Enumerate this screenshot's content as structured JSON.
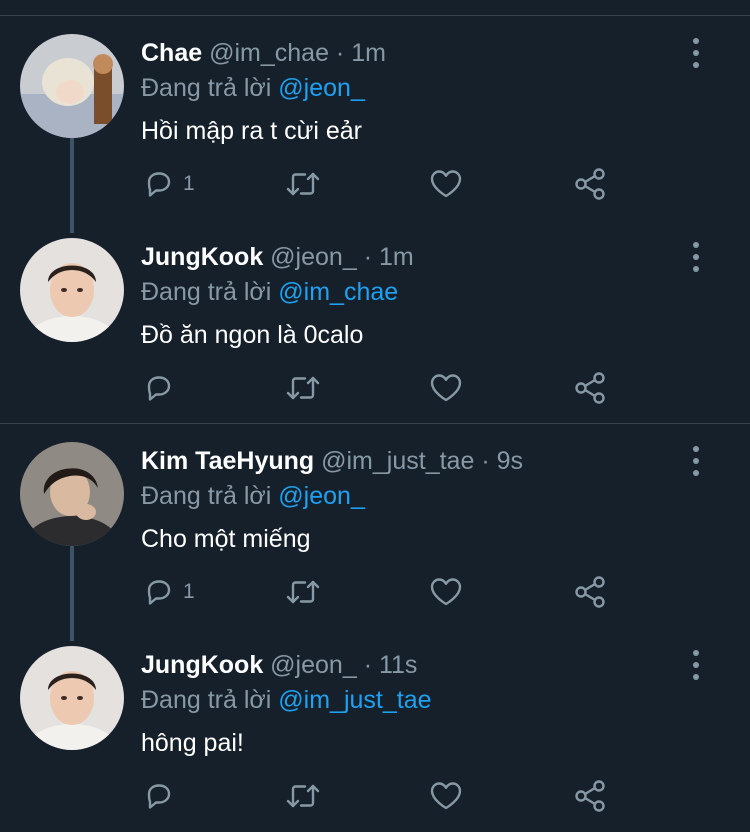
{
  "labels": {
    "replying_prefix": "Đang trả lời"
  },
  "colors": {
    "background": "#15202b",
    "name": "#ffffff",
    "secondary": "#8899a6",
    "mention": "#1da1f2",
    "thread_line": "#3d5466"
  },
  "tweets": [
    {
      "name": "Chae",
      "handle": "@im_chae",
      "dot": "·",
      "time": "1m",
      "mention": "@jeon_",
      "text": "Hồi mập ra t cừi eảr",
      "reply_count": "1",
      "avatar_icon": "avatar-chae"
    },
    {
      "name": "JungKook",
      "handle": "@jeon_",
      "dot": "·",
      "time": "1m",
      "mention": "@im_chae",
      "text": "Đồ ăn ngon là 0calo",
      "reply_count": "",
      "avatar_icon": "avatar-jungkook"
    },
    {
      "name": "Kim TaeHyung",
      "handle": "@im_just_tae",
      "dot": "·",
      "time": "9s",
      "mention": "@jeon_",
      "text": "Cho một miếng",
      "reply_count": "1",
      "avatar_icon": "avatar-taehyung"
    },
    {
      "name": "JungKook",
      "handle": "@jeon_",
      "dot": "·",
      "time": "11s",
      "mention": "@im_just_tae",
      "text": "hông pai!",
      "reply_count": "",
      "avatar_icon": "avatar-jungkook"
    }
  ]
}
